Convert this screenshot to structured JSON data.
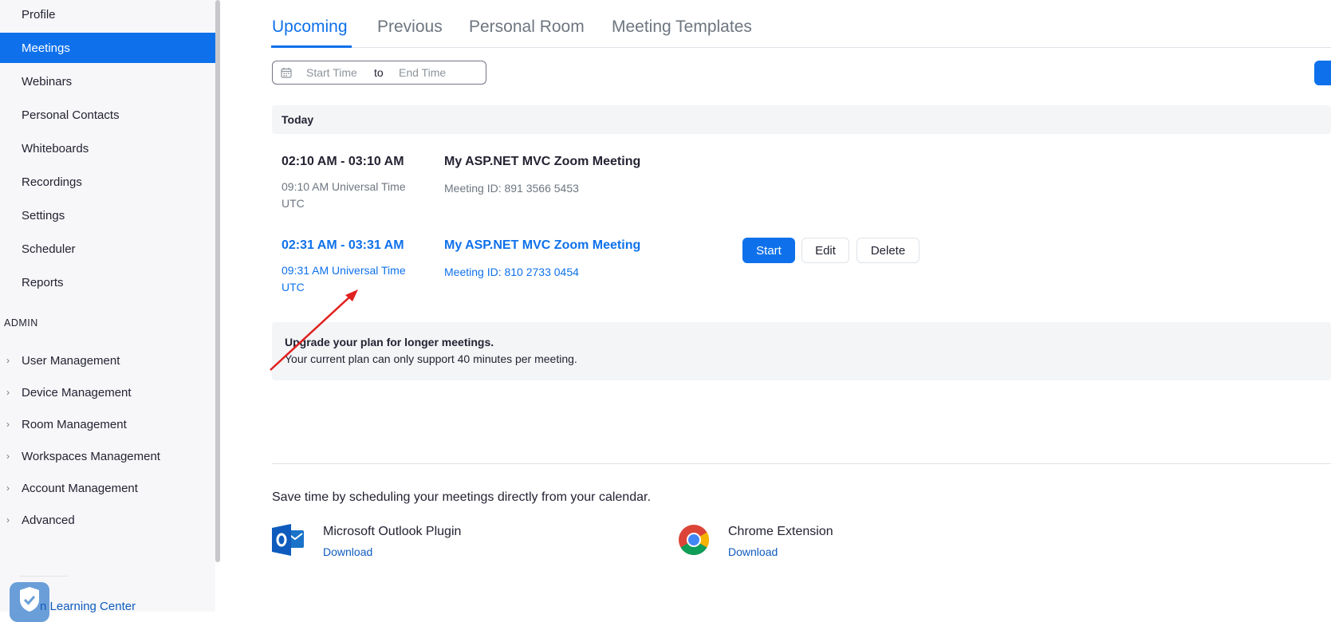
{
  "sidebar": {
    "items": [
      {
        "label": "Profile",
        "active": false
      },
      {
        "label": "Meetings",
        "active": true
      },
      {
        "label": "Webinars",
        "active": false
      },
      {
        "label": "Personal Contacts",
        "active": false
      },
      {
        "label": "Whiteboards",
        "active": false
      },
      {
        "label": "Recordings",
        "active": false
      },
      {
        "label": "Settings",
        "active": false
      },
      {
        "label": "Scheduler",
        "active": false
      },
      {
        "label": "Reports",
        "active": false
      }
    ],
    "admin_heading": "ADMIN",
    "admin_items": [
      {
        "label": "User Management"
      },
      {
        "label": "Device Management"
      },
      {
        "label": "Room Management"
      },
      {
        "label": "Workspaces Management"
      },
      {
        "label": "Account Management"
      },
      {
        "label": "Advanced"
      }
    ],
    "learning_center": "n Learning Center"
  },
  "tabs": [
    {
      "label": "Upcoming",
      "active": true
    },
    {
      "label": "Previous",
      "active": false
    },
    {
      "label": "Personal Room",
      "active": false
    },
    {
      "label": "Meeting Templates",
      "active": false
    }
  ],
  "date_range": {
    "start_placeholder": "Start Time",
    "separator": "to",
    "end_placeholder": "End Time"
  },
  "today_label": "Today",
  "meetings": [
    {
      "time": "02:10 AM - 03:10 AM",
      "tz_line1": "09:10 AM Universal Time",
      "tz_line2": "UTC",
      "topic": "My ASP.NET MVC Zoom Meeting",
      "meeting_id": "Meeting ID: 891 3566 5453"
    },
    {
      "time": "02:31 AM - 03:31 AM",
      "tz_line1": "09:31 AM Universal Time",
      "tz_line2": "UTC",
      "topic": "My ASP.NET MVC Zoom Meeting",
      "meeting_id": "Meeting ID: 810 2733 0454"
    }
  ],
  "actions": {
    "start": "Start",
    "edit": "Edit",
    "delete": "Delete"
  },
  "upgrade": {
    "title": "Upgrade your plan for longer meetings.",
    "text": "Your current plan can only support 40 minutes per meeting."
  },
  "calendar_text": "Save time by scheduling your meetings directly from your calendar.",
  "plugins": [
    {
      "name": "Microsoft Outlook Plugin",
      "link": "Download",
      "icon": "outlook-icon"
    },
    {
      "name": "Chrome Extension",
      "link": "Download",
      "icon": "chrome-icon"
    }
  ],
  "colors": {
    "accent": "#0e71eb",
    "sidebar_bg": "#f7f7f9",
    "annotation_arrow": "#e0201f"
  }
}
